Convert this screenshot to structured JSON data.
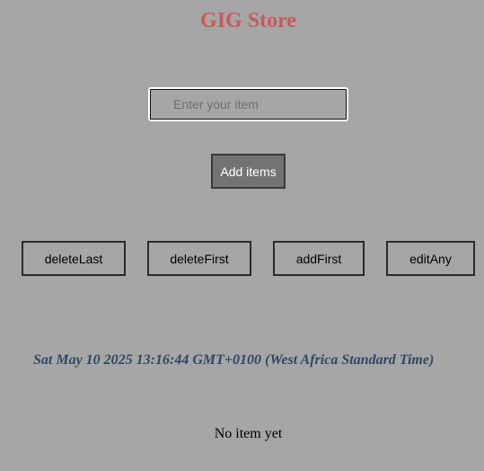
{
  "header": {
    "title": "GIG Store"
  },
  "form": {
    "item_placeholder": "Enter your item",
    "item_value": "",
    "add_button_label": "Add items"
  },
  "actions": {
    "delete_last_label": "deleteLast",
    "delete_first_label": "deleteFirst",
    "add_first_label": "addFirst",
    "edit_any_label": "editAny"
  },
  "status": {
    "datetime": "Sat May 10 2025 13:16:44 GMT+0100 (West Africa Standard Time)",
    "items_message": "No item yet"
  },
  "colors": {
    "background": "#a6a6a6",
    "title": "#c85a5a",
    "datetime": "#2e4766",
    "add_button_bg": "#737373"
  }
}
